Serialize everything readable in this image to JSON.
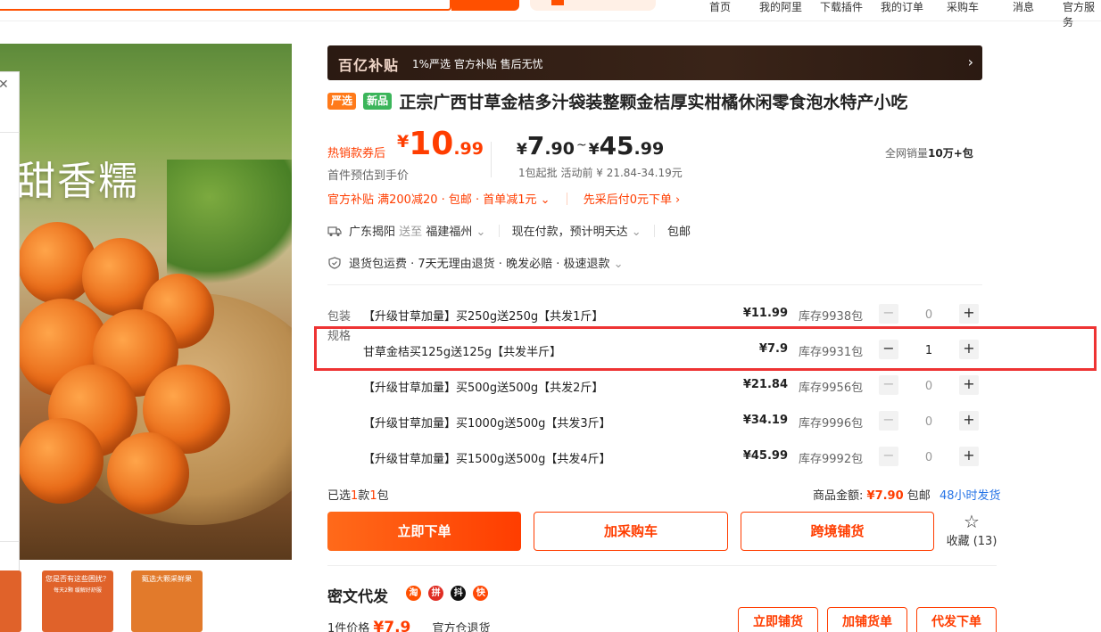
{
  "topbar": {
    "nav": [
      "首页",
      "我的阿里",
      "下载插件",
      "我的订单",
      "采购车",
      "消息",
      "官方服务"
    ]
  },
  "hero": {
    "text": "甜香糯",
    "close_icon": "close-icon"
  },
  "thumbnails": [
    {
      "title": "您是否有这些困扰？",
      "sub": "每天2颗 缓解好舒服",
      "color": "#e0622a"
    },
    {
      "title": "甄选大颗采鲜果",
      "sub": "",
      "color": "#e27a2b"
    },
    {
      "title": "",
      "sub": "",
      "color": "#ffffff"
    }
  ],
  "banner": {
    "brand": "百亿补贴",
    "desc": "1%严选 官方补贴 售后无忧",
    "arrow_icon": "chevron-right-icon"
  },
  "product": {
    "tag_strict": "严选",
    "tag_new": "新品",
    "title": "正宗广西甘草金桔多汁袋装整颗金桔厚实柑橘休闲零食泡水特产小吃"
  },
  "price": {
    "coupon_label": "热销款券后",
    "yen": "¥",
    "main_int": "10",
    "main_dec": ".99",
    "estimate_label": "首件预估到手价",
    "range_low_int": "7",
    "range_low_dec": ".90",
    "range_tilde": "~",
    "range_high_int": "45",
    "range_high_dec": ".99",
    "range_sub": "1包起批 活动前 ¥ 21.84-34.19元",
    "sales_prefix": "全网销量",
    "sales_value": "10万+包"
  },
  "promo": {
    "text": "官方补贴 满200减20 · 包邮 · 首单减1元",
    "pay_later": "先采后付0元下单"
  },
  "shipping": {
    "from": "广东揭阳",
    "to_label": "送至",
    "to": "福建福州",
    "delivery": "现在付款，预计明天达",
    "free": "包邮"
  },
  "service": {
    "text": "退货包运费 · 7天无理由退货 · 晚发必赔 · 极速退款"
  },
  "spec": {
    "label_pack": "包装",
    "label_spec": "规格",
    "rows": [
      {
        "name": "【升级甘草加量】买250g送250g【共发1斤】",
        "price": "¥11.99",
        "stock": "库存9938包",
        "qty": "0"
      },
      {
        "name": "甘草金桔买125g送125g【共发半斤】",
        "price": "¥7.9",
        "stock": "库存9931包",
        "qty": "1"
      },
      {
        "name": "【升级甘草加量】买500g送500g【共发2斤】",
        "price": "¥21.84",
        "stock": "库存9956包",
        "qty": "0"
      },
      {
        "name": "【升级甘草加量】买1000g送500g【共发3斤】",
        "price": "¥34.19",
        "stock": "库存9996包",
        "qty": "0"
      },
      {
        "name": "【升级甘草加量】买1500g送500g【共发4斤】",
        "price": "¥45.99",
        "stock": "库存9992包",
        "qty": "0"
      }
    ],
    "minus": "−",
    "plus": "+"
  },
  "summary": {
    "selected_prefix": "已选",
    "selected_kinds": "1",
    "selected_mid": "款",
    "selected_count": "1",
    "selected_suffix": "包",
    "total_label": "商品金额:",
    "total_value": "¥7.90",
    "free_ship": "包邮",
    "dispatch": "48小时发货"
  },
  "actions": {
    "buy_now": "立即下单",
    "add_cart": "加采购车",
    "cross_border": "跨境铺货",
    "favorite": "收藏 (13)"
  },
  "dropship": {
    "title": "密文代发",
    "platforms": [
      {
        "label": "淘",
        "color": "#ff5000"
      },
      {
        "label": "拼",
        "color": "#e02e24"
      },
      {
        "label": "抖",
        "color": "#111111"
      },
      {
        "label": "快",
        "color": "#ff4906"
      }
    ],
    "unit_label": "1件价格",
    "unit_price": "¥7.9",
    "return_note": "官方仓退货",
    "btn_list": "立即铺货",
    "btn_add": "加铺货单",
    "btn_ship": "代发下单"
  },
  "colors": {
    "accent": "#ff3d00",
    "highlight": "#e33333",
    "link": "#2573e6"
  }
}
